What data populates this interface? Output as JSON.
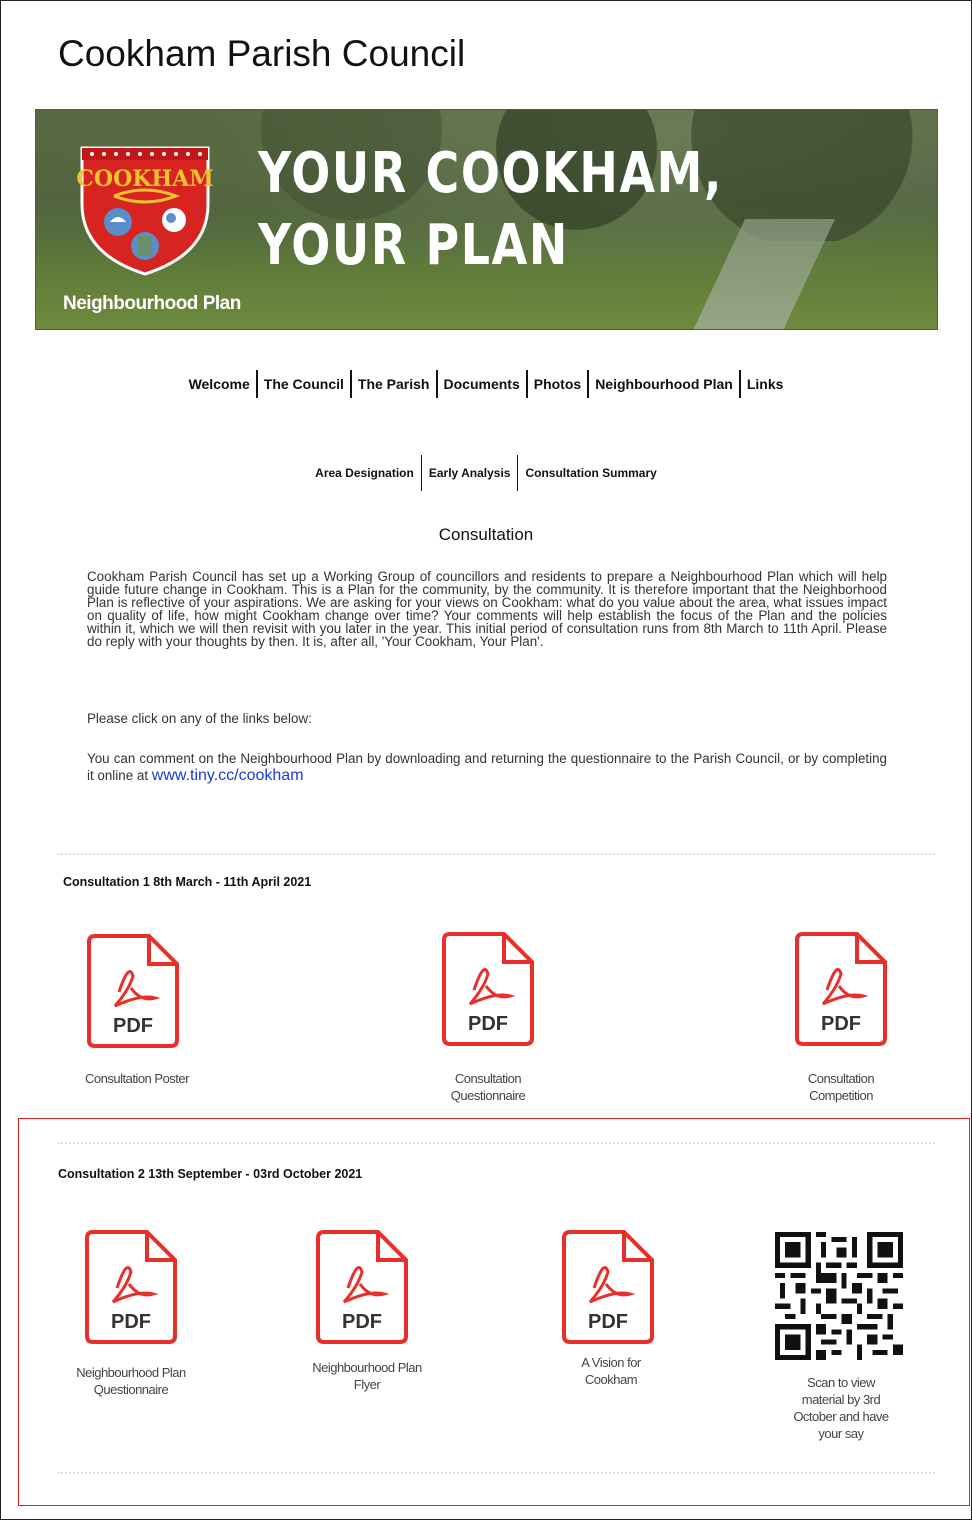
{
  "site": {
    "title": "Cookham Parish Council"
  },
  "banner": {
    "headline_line1": "YOUR COOKHAM,",
    "headline_line2": "YOUR PLAN",
    "subtitle": "Neighbourhood Plan",
    "crest_text": "COOKHAM"
  },
  "nav": {
    "items": [
      "Welcome",
      "The Council",
      "The Parish",
      "Documents",
      "Photos",
      "Neighbourhood Plan",
      "Links"
    ]
  },
  "subnav": {
    "items": [
      "Area Designation",
      "Early Analysis",
      "Consultation Summary"
    ]
  },
  "content": {
    "heading": "Consultation",
    "intro": "Cookham Parish Council has set up a Working Group of councillors and residents to prepare a Neighbourhood Plan which will help guide future change in Cookham.  This is a Plan for the community, by the community.  It is therefore important that the Neighborhood Plan is reflective of your aspirations.  We are asking for your views on Cookham: what do you value about the area, what issues impact on quality of life, how might Cookham change over time?  Your comments will help establish the focus of the Plan and the policies within it, which we will then revisit with you later in the year.  This initial period of consultation runs from 8th March to 11th April.  Please do reply with your thoughts by then.  It is, after all, 'Your Cookham, Your Plan'.",
    "click_prompt": "Please click on any of the links below:",
    "comment_text": "You can comment on the Neighbourhood Plan by downloading and returning the questionnaire to the Parish Council, or by completing it online at",
    "online_link": "www.tiny.cc/cookham"
  },
  "consultation1": {
    "heading": "Consultation 1 8th March - 11th April 2021",
    "files": [
      {
        "label_line1": "Consultation Poster",
        "label_line2": "",
        "icon_text": "PDF"
      },
      {
        "label_line1": "Consultation",
        "label_line2": "Questionnaire",
        "icon_text": "PDF"
      },
      {
        "label_line1": "Consultation",
        "label_line2": "Competition",
        "icon_text": "PDF"
      }
    ]
  },
  "consultation2": {
    "heading": "Consultation 2 13th September - 03rd October 2021",
    "files": [
      {
        "label_line1": "Neighbourhood Plan",
        "label_line2": "Questionnaire",
        "icon_text": "PDF"
      },
      {
        "label_line1": "Neighbourhood Plan",
        "label_line2": "Flyer",
        "icon_text": "PDF"
      },
      {
        "label_line1": "A Vision for",
        "label_line2": "Cookham",
        "icon_text": "PDF"
      }
    ],
    "qr_caption": [
      "Scan to view",
      "material by 3rd",
      "October and have",
      "your say"
    ]
  },
  "colors": {
    "pdf_red": "#e8302a",
    "link_blue": "#1a3bd6",
    "highlight_red": "#dd2222"
  }
}
